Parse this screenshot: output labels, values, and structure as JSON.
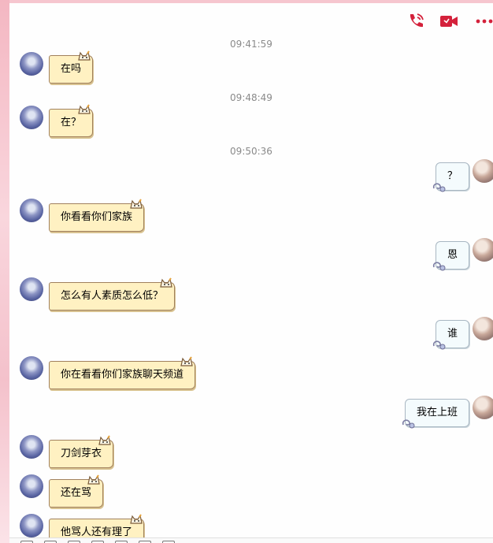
{
  "header": {
    "icons": [
      "phone-call-icon",
      "video-call-icon",
      "more-icon"
    ],
    "accent": "#d4213b"
  },
  "timestamps": [
    "09:41:59",
    "09:48:49",
    "09:50:36"
  ],
  "messages": [
    {
      "from": "peer",
      "text": "在吗"
    },
    {
      "from": "peer",
      "text": "在？"
    },
    {
      "from": "me",
      "text": "？"
    },
    {
      "from": "peer",
      "text": "你看看你们家族"
    },
    {
      "from": "me",
      "text": "恩"
    },
    {
      "from": "peer",
      "text": "怎么有人素质怎么低？"
    },
    {
      "from": "me",
      "text": "谁"
    },
    {
      "from": "peer",
      "text": "你在看看你们家族聊天频道"
    },
    {
      "from": "me",
      "text": "我在上班"
    },
    {
      "from": "peer",
      "text": "刀剑芽衣"
    },
    {
      "from": "peer",
      "text": "还在骂"
    },
    {
      "from": "peer",
      "text": "他骂人还有理了"
    }
  ]
}
